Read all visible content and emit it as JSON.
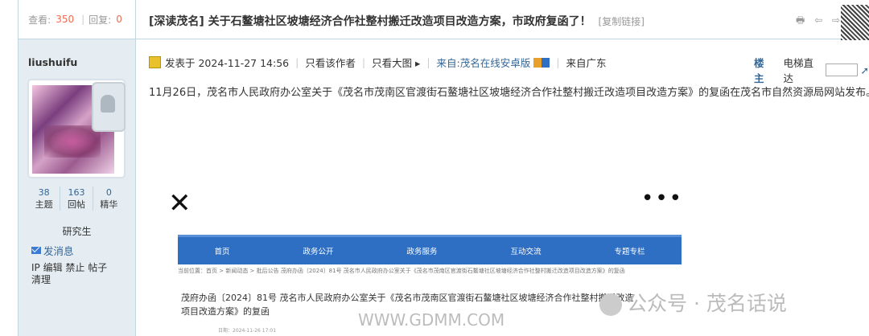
{
  "sidebar": {
    "views_label": "查看:",
    "views": "350",
    "replies_label": "回复:",
    "replies": "0",
    "username": "liushuifu",
    "stats": [
      {
        "value": "38",
        "label": "主题"
      },
      {
        "value": "163",
        "label": "回帖"
      },
      {
        "value": "0",
        "label": "精华"
      }
    ],
    "rank": "研究生",
    "send_message": "发消息",
    "ops_line1": "IP 编辑 禁止 帖子",
    "ops_line2": "清理"
  },
  "thread": {
    "tag": "[深读茂名]",
    "title": "关于石鳌塘社区坡塘经济合作社整村搬迁改造项目改造方案，市政府复函了！",
    "copy_link": "[复制链接]",
    "icons": "🖶 ⇦ ⇨",
    "posted_at": "发表于 2024-11-27 14:56",
    "only_author": "只看该作者",
    "only_big_img": "只看大图 ▸",
    "source": "来自:茂名在线安卓版",
    "from": "来自广东",
    "floor_label": "楼主",
    "elevator": "电梯直达",
    "content": "11月26日，茂名市人民政府办公室关于《茂名市茂南区官渡街石鳌塘社区坡塘经济合作社整村搬迁改造项目改造方案》的复函在茂名市自然资源局网站发布。"
  },
  "image": {
    "close": "✕",
    "more": "•••",
    "nav": [
      "首页",
      "政务公开",
      "政务服务",
      "互动交流",
      "专题专栏"
    ],
    "crumb": "当前位置：首页 > 新闻动态 > 批后公告 茂府办函〔2024〕81号 茂名市人民政府办公室关于《茂名市茂南区官渡街石鳌塘社区坡塘经济合作社整村搬迁改造项目改造方案》的复函",
    "doc_title": "茂府办函〔2024〕81号 茂名市人民政府办公室关于《茂名市茂南区官渡街石鳌塘社区坡塘经济合作社整村搬迁改造项目改造方案》的复函",
    "watermark": "公众号 · 茂名话说",
    "watermark2": "WWW.GDMM.COM",
    "date": "日期：2024-11-26 17:01"
  }
}
